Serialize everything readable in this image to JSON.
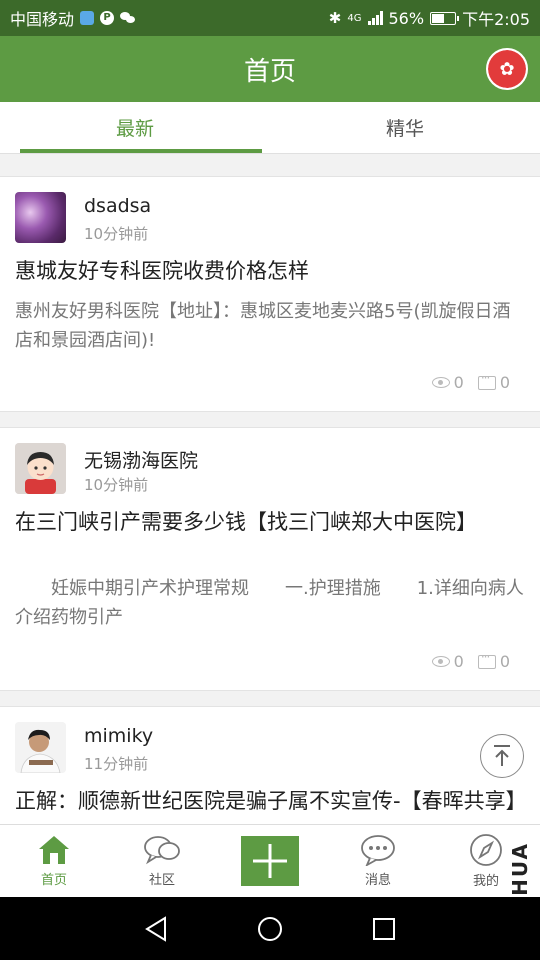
{
  "status_bar": {
    "carrier": "中国移动",
    "battery_percent": "56%",
    "battery_level": 0.56,
    "network_label": "4G",
    "time": "下午2:05"
  },
  "header": {
    "title": "首页"
  },
  "tabs": [
    {
      "label": "最新",
      "active": true
    },
    {
      "label": "精华",
      "active": false
    }
  ],
  "posts": [
    {
      "username": "dsadsa",
      "time": "10分钟前",
      "title": "惠城友好专科医院收费价格怎样",
      "excerpt": "惠州友好男科医院【地址】：惠城区麦地麦兴路5号(凯旋假日酒店和景园酒店间)!",
      "views": "0",
      "comments": "0"
    },
    {
      "username": "无锡渤海医院",
      "time": "10分钟前",
      "title": "在三门峡引产需要多少钱【找三门峡郑大中医院】",
      "excerpt": "　　妊娠中期引产术护理常规　　一.护理措施　　1.详细向病人介绍药物引产",
      "views": "0",
      "comments": "0"
    },
    {
      "username": "mimiky",
      "time": "11分钟前",
      "title": "正解：顺德新世纪医院是骗子属不实宣传-【春晖共享】",
      "excerpt": "",
      "views": "",
      "comments": ""
    }
  ],
  "bottom_nav": {
    "home_label": "首页",
    "community_label": "社区",
    "messages_label": "消息",
    "mine_label": "我的",
    "brand_text": "HUA"
  },
  "colors": {
    "brand_green": "#5d9b43",
    "status_bar": "#3c6a2a"
  }
}
